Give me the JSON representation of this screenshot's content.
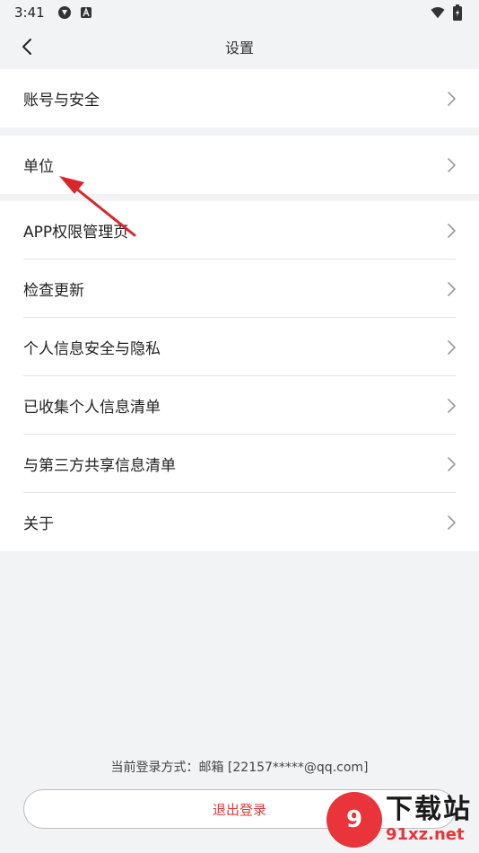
{
  "status_bar": {
    "time": "3:41",
    "left_icons": [
      "sync-icon",
      "a-icon"
    ],
    "right_icons": [
      "wifi-icon",
      "battery-icon"
    ]
  },
  "header": {
    "title": "设置",
    "back_icon": "chevron-left-icon"
  },
  "groups": [
    {
      "items": [
        {
          "label": "账号与安全"
        }
      ]
    },
    {
      "items": [
        {
          "label": "单位"
        }
      ]
    },
    {
      "items": [
        {
          "label": "APP权限管理页"
        },
        {
          "label": "检查更新"
        },
        {
          "label": "个人信息安全与隐私"
        },
        {
          "label": "已收集个人信息清单"
        },
        {
          "label": "与第三方共享信息清单"
        },
        {
          "label": "关于"
        }
      ]
    }
  ],
  "footer": {
    "login_info": "当前登录方式：邮箱 [22157*****@qq.com]",
    "logout_label": "退出登录"
  },
  "watermark": {
    "badge": "9",
    "cn": "下载站",
    "en": "91xz.net"
  },
  "colors": {
    "background": "#f2f3f5",
    "card": "#ffffff",
    "accent_red": "#e03a3a",
    "annotation_arrow": "#d8262b"
  }
}
